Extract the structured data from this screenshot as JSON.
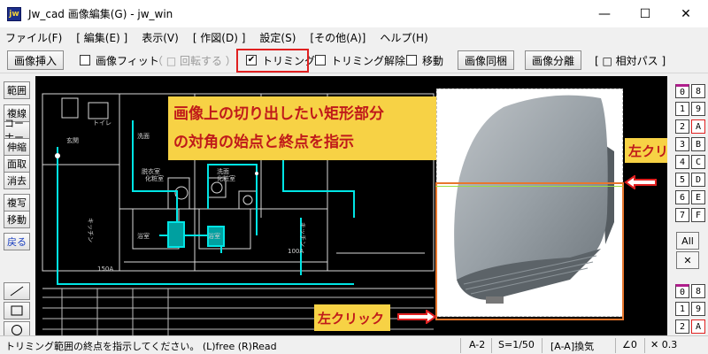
{
  "window": {
    "icon": "jw",
    "title": "Jw_cad 画像編集(G) - jw_win",
    "minimize": "—",
    "maximize": "☐",
    "close": "✕"
  },
  "menu": [
    "ファイル(F)",
    "[ 編集(E) ]",
    "表示(V)",
    "[ 作図(D) ]",
    "設定(S)",
    "[その他(A)]",
    "ヘルプ(H)"
  ],
  "toolbar": {
    "insert": "画像挿入",
    "fit": "画像フィット",
    "rotate": "（ □ 回転する ）",
    "trim": "トリミング",
    "trim_release": "トリミング解除",
    "move": "移動",
    "embed": "画像同梱",
    "separate": "画像分離",
    "relative": "[ □ 相対パス ]"
  },
  "left_tools": [
    "範囲",
    "複線",
    "コーナー",
    "伸縮",
    "面取",
    "消去",
    "複写",
    "移動",
    "戻る"
  ],
  "canvas": {
    "rooms": [
      "玄関",
      "トイレ",
      "洗面",
      "脱衣室",
      "洗濯",
      "化粧室",
      "洗面",
      "化粧室",
      "キッチン",
      "浴室",
      "浴室",
      "キッチン"
    ],
    "dims": [
      "150A",
      "100A"
    ]
  },
  "annotations": {
    "instruction_line1": "画像上の切り出したい矩形部分",
    "instruction_line2": "の対角の始点と終点を指示",
    "click1": "左クリック",
    "click2": "左クリック"
  },
  "right_panel": {
    "top_col1": [
      "0",
      "1",
      "2",
      "3",
      "4",
      "5",
      "6",
      "7"
    ],
    "top_col2": [
      "8",
      "9",
      "A",
      "B",
      "C",
      "D",
      "E",
      "F"
    ],
    "all": "All",
    "x": "✕",
    "bot_col1": [
      "0",
      "1",
      "2"
    ],
    "bot_col2": [
      "8",
      "9",
      "A"
    ]
  },
  "status": {
    "message": "トリミング範囲の終点を指示してください。 (L)free (R)Read",
    "layer": "A-2",
    "scale": "S=1/50",
    "layer_name": "[A-A]換気",
    "angle": "∠0",
    "zoom": "✕ 0.3"
  },
  "colors": {
    "accent_red": "#e02020",
    "note_bg": "#f7d245",
    "note_text": "#c01a1a",
    "crop_frame": "#e8772d",
    "cad_cyan": "#00e5e5"
  }
}
